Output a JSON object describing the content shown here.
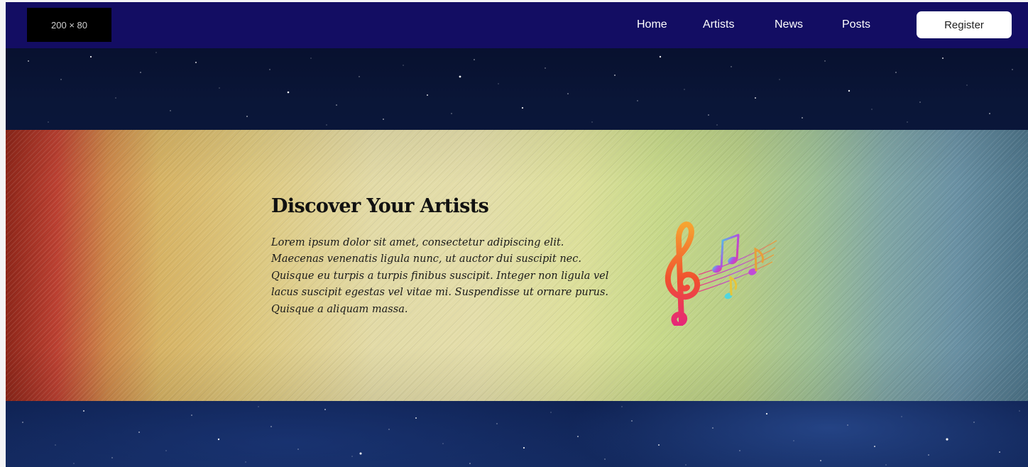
{
  "navbar": {
    "logo_text": "200 × 80",
    "links": [
      {
        "label": "Home"
      },
      {
        "label": "Artists"
      },
      {
        "label": "News"
      },
      {
        "label": "Posts"
      }
    ],
    "register_label": "Register",
    "background_color": "#130d63"
  },
  "hero": {
    "title": "Discover Your Artists",
    "body": "Lorem ipsum dolor sit amet, consectetur adipiscing elit. Maecenas venenatis ligula nunc, ut auctor dui suscipit nec. Quisque eu turpis a turpis finibus suscipit. Integer non ligula vel lacus suscipit egestas vel vitae mi. Suspendisse ut ornare purus. Quisque a aliquam massa.",
    "icon": "music-notes-icon"
  }
}
